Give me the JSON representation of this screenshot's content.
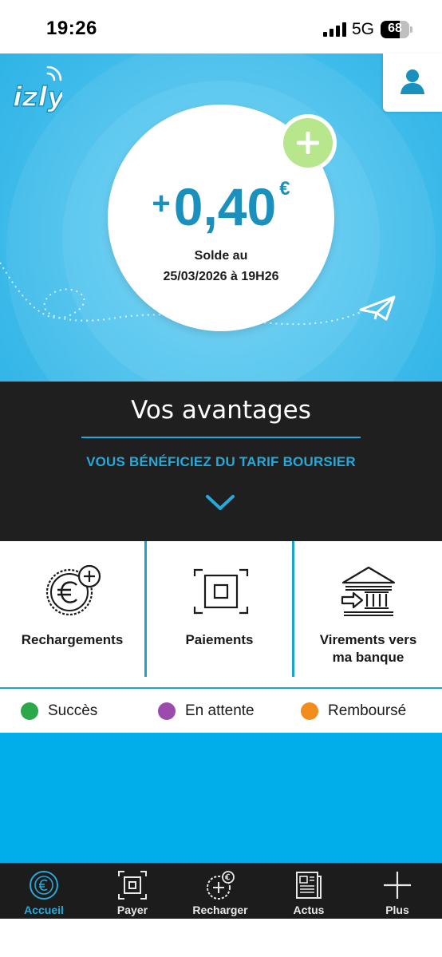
{
  "status_bar": {
    "time": "19:26",
    "network": "5G",
    "battery": "68",
    "battery_level": 0.68
  },
  "hero": {
    "logo_text": "izly",
    "balance_sign": "+",
    "balance_value": "0,40",
    "balance_currency": "€",
    "balance_label": "Solde au",
    "balance_date": "25/03/2026 à 19H26",
    "icons": [
      "profile-icon",
      "plus-icon",
      "paper-plane-icon"
    ]
  },
  "advantages": {
    "title": "Vos avantages",
    "subtitle": "VOUS BÉNÉFICIEZ DU TARIF BOURSIER",
    "icon": "chevron-down-icon"
  },
  "actions": [
    {
      "label": "Rechargements",
      "icon": "euro-coin-plus-icon"
    },
    {
      "label": "Paiements",
      "icon": "scan-frame-icon"
    },
    {
      "label_line1": "Virements vers",
      "label_line2": "ma banque",
      "icon": "bank-transfer-icon"
    }
  ],
  "legend": [
    {
      "label": "Succès",
      "color": "#2aa84a"
    },
    {
      "label": "En attente",
      "color": "#9b4aae"
    },
    {
      "label": "Remboursé",
      "color": "#f28c1c"
    }
  ],
  "tab_bar": {
    "active": "Accueil",
    "tabs": [
      {
        "label": "Accueil",
        "icon": "euro-circle-icon"
      },
      {
        "label": "Payer",
        "icon": "scan-frame-icon"
      },
      {
        "label": "Recharger",
        "icon": "recharge-icon"
      },
      {
        "label": "Actus",
        "icon": "newspaper-icon"
      },
      {
        "label": "Plus",
        "icon": "plus-icon"
      }
    ]
  },
  "colors": {
    "brand_blue": "#29a8d8",
    "hero_blue": "#4cc3ee",
    "background_blue": "#01aeea",
    "dark": "#1f1f1f",
    "add_green": "#b7e68d"
  }
}
